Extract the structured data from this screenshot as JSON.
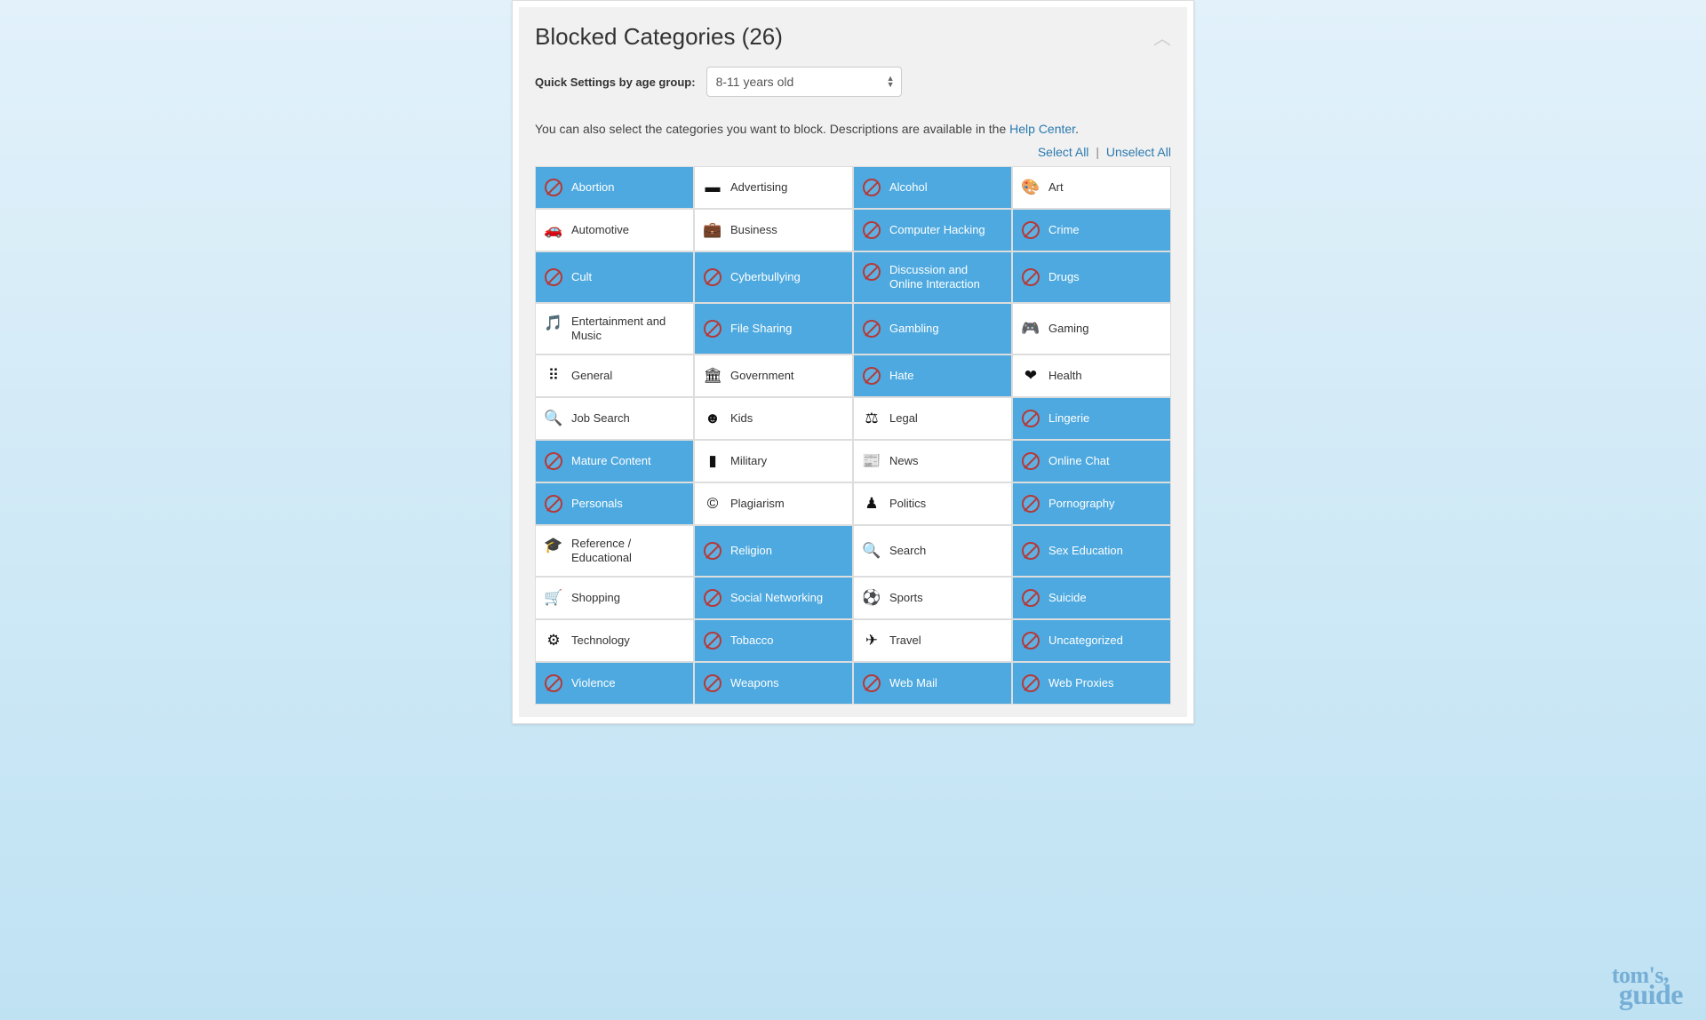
{
  "header": {
    "title": "Blocked Categories (26)"
  },
  "quick": {
    "label": "Quick Settings by age group:",
    "selected": "8-11 years old"
  },
  "description": {
    "text_before": "You can also select the categories you want to block. Descriptions are available in the ",
    "link_text": "Help Center",
    "text_after": "."
  },
  "actions": {
    "select_all": "Select All",
    "unselect_all": "Unselect All"
  },
  "categories": [
    {
      "label": "Abortion",
      "selected": true,
      "icon": "block",
      "glyph": "⊘"
    },
    {
      "label": "Advertising",
      "selected": false,
      "icon": "billboard",
      "glyph": "▬"
    },
    {
      "label": "Alcohol",
      "selected": true,
      "icon": "block",
      "glyph": "🍸"
    },
    {
      "label": "Art",
      "selected": false,
      "icon": "palette",
      "glyph": "🎨"
    },
    {
      "label": "Automotive",
      "selected": false,
      "icon": "car",
      "glyph": "🚗"
    },
    {
      "label": "Business",
      "selected": false,
      "icon": "briefcase",
      "glyph": "💼"
    },
    {
      "label": "Computer Hacking",
      "selected": true,
      "icon": "block",
      "glyph": "⊘"
    },
    {
      "label": "Crime",
      "selected": true,
      "icon": "block",
      "glyph": "⊘"
    },
    {
      "label": "Cult",
      "selected": true,
      "icon": "block",
      "glyph": "⊘"
    },
    {
      "label": "Cyberbullying",
      "selected": true,
      "icon": "block",
      "glyph": "⊘"
    },
    {
      "label": "Discussion and Online Interaction",
      "selected": true,
      "icon": "block",
      "glyph": "⊘"
    },
    {
      "label": "Drugs",
      "selected": true,
      "icon": "block",
      "glyph": "⊘"
    },
    {
      "label": "Entertainment and Music",
      "selected": false,
      "icon": "music",
      "glyph": "🎵"
    },
    {
      "label": "File Sharing",
      "selected": true,
      "icon": "block",
      "glyph": "⊘"
    },
    {
      "label": "Gambling",
      "selected": true,
      "icon": "block",
      "glyph": "⊘"
    },
    {
      "label": "Gaming",
      "selected": false,
      "icon": "gamepad",
      "glyph": "🎮"
    },
    {
      "label": "General",
      "selected": false,
      "icon": "grid",
      "glyph": "⠿"
    },
    {
      "label": "Government",
      "selected": false,
      "icon": "bank",
      "glyph": "🏛"
    },
    {
      "label": "Hate",
      "selected": true,
      "icon": "block",
      "glyph": "⊘"
    },
    {
      "label": "Health",
      "selected": false,
      "icon": "heart",
      "glyph": "❤"
    },
    {
      "label": "Job Search",
      "selected": false,
      "icon": "search-user",
      "glyph": "🔍"
    },
    {
      "label": "Kids",
      "selected": false,
      "icon": "smile",
      "glyph": "☻"
    },
    {
      "label": "Legal",
      "selected": false,
      "icon": "scales",
      "glyph": "⚖"
    },
    {
      "label": "Lingerie",
      "selected": true,
      "icon": "block",
      "glyph": "⊘"
    },
    {
      "label": "Mature Content",
      "selected": true,
      "icon": "block",
      "glyph": "⊘"
    },
    {
      "label": "Military",
      "selected": false,
      "icon": "military",
      "glyph": "▮"
    },
    {
      "label": "News",
      "selected": false,
      "icon": "news",
      "glyph": "📰"
    },
    {
      "label": "Online Chat",
      "selected": true,
      "icon": "block",
      "glyph": "⊘"
    },
    {
      "label": "Personals",
      "selected": true,
      "icon": "block",
      "glyph": "⊘"
    },
    {
      "label": "Plagiarism",
      "selected": false,
      "icon": "copyright",
      "glyph": "©"
    },
    {
      "label": "Politics",
      "selected": false,
      "icon": "podium",
      "glyph": "♟"
    },
    {
      "label": "Pornography",
      "selected": true,
      "icon": "block",
      "glyph": "⊘"
    },
    {
      "label": "Reference / Educational",
      "selected": false,
      "icon": "grad",
      "glyph": "🎓"
    },
    {
      "label": "Religion",
      "selected": true,
      "icon": "block",
      "glyph": "⊘"
    },
    {
      "label": "Search",
      "selected": false,
      "icon": "search",
      "glyph": "🔍"
    },
    {
      "label": "Sex Education",
      "selected": true,
      "icon": "block",
      "glyph": "⊘"
    },
    {
      "label": "Shopping",
      "selected": false,
      "icon": "cart",
      "glyph": "🛒"
    },
    {
      "label": "Social Networking",
      "selected": true,
      "icon": "block",
      "glyph": "⊘"
    },
    {
      "label": "Sports",
      "selected": false,
      "icon": "ball",
      "glyph": "⚽"
    },
    {
      "label": "Suicide",
      "selected": true,
      "icon": "block",
      "glyph": "⊘"
    },
    {
      "label": "Technology",
      "selected": false,
      "icon": "cpu",
      "glyph": "⚙"
    },
    {
      "label": "Tobacco",
      "selected": true,
      "icon": "block",
      "glyph": "⊘"
    },
    {
      "label": "Travel",
      "selected": false,
      "icon": "plane",
      "glyph": "✈"
    },
    {
      "label": "Uncategorized",
      "selected": true,
      "icon": "block",
      "glyph": "⊘"
    },
    {
      "label": "Violence",
      "selected": true,
      "icon": "block",
      "glyph": "⊘"
    },
    {
      "label": "Weapons",
      "selected": true,
      "icon": "block",
      "glyph": "⊘"
    },
    {
      "label": "Web Mail",
      "selected": true,
      "icon": "block",
      "glyph": "⊘"
    },
    {
      "label": "Web Proxies",
      "selected": true,
      "icon": "block",
      "glyph": "⊘"
    }
  ],
  "watermark": {
    "line1": "tom's",
    "line2": "guide"
  }
}
